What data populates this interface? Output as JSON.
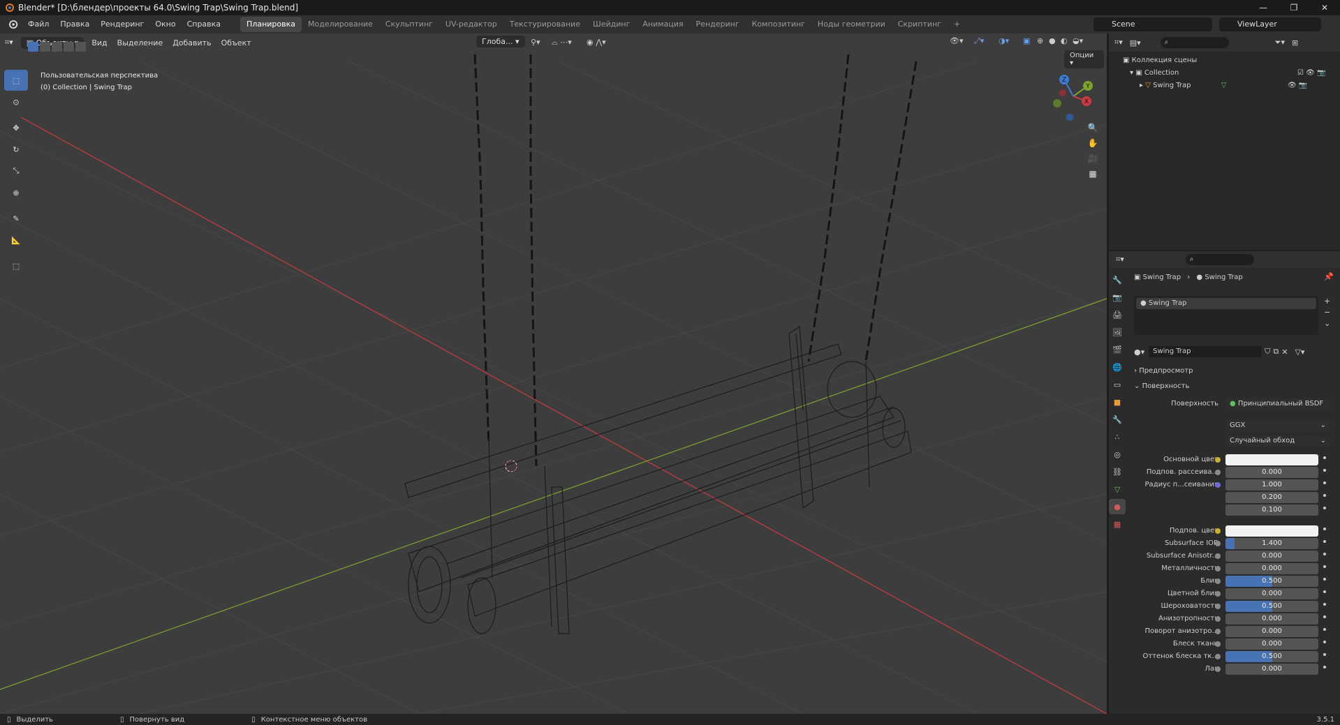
{
  "window": {
    "title": "Blender* [D:\\блендер\\проекты 64.0\\Swing Trap\\Swing Trap.blend]",
    "controls": [
      "—",
      "❐",
      "✕"
    ]
  },
  "menubar": {
    "menus": [
      "Файл",
      "Правка",
      "Рендеринг",
      "Окно",
      "Справка"
    ],
    "workspaces": [
      "Планировка",
      "Моделирование",
      "Скульптинг",
      "UV-редактор",
      "Текстурирование",
      "Шейдинг",
      "Анимация",
      "Рендеринг",
      "Композитинг",
      "Ноды геометрии",
      "Скриптинг",
      "+"
    ],
    "active_workspace": "Планировка",
    "scene": "Scene",
    "view_layer": "ViewLayer"
  },
  "viewport": {
    "mode": "Объекты",
    "menus": [
      "Вид",
      "Выделение",
      "Добавить",
      "Объект"
    ],
    "transform_orientation": "Глоба...",
    "options_label": "Опции",
    "overlay_text_1": "Пользовательская перспектива",
    "overlay_text_2": "(0) Collection | Swing Trap",
    "gizmo_axes": [
      "X",
      "Y",
      "Z"
    ]
  },
  "outliner": {
    "search_placeholder": "",
    "scene_collection": "Коллекция сцены",
    "collection": "Collection",
    "object": "Swing Trap"
  },
  "properties": {
    "breadcrumb_object": "Swing Trap",
    "breadcrumb_material": "Swing Trap",
    "material_slot": "Swing Trap",
    "material_name": "Swing Trap",
    "panel_preview": "Предпросмотр",
    "panel_surface": "Поверхность",
    "surface_label": "Поверхность",
    "surface_shader": "Принципиальный BSDF",
    "distribution": "GGX",
    "subsurface_method": "Случайный обход",
    "rows": [
      {
        "label": "Основной цвет",
        "value": "",
        "type": "color",
        "dot": "yellow"
      },
      {
        "label": "Подпов. рассеива...",
        "value": "0.000",
        "fill": 0,
        "dot": "grey"
      },
      {
        "label": "Радиус п...сеивания",
        "value": "1.000",
        "fill": 0,
        "dot": "blue"
      },
      {
        "label": "",
        "value": "0.200",
        "fill": 0,
        "dot": "none"
      },
      {
        "label": "",
        "value": "0.100",
        "fill": 0,
        "dot": "none"
      },
      {
        "label": "Подпов. цвет",
        "value": "",
        "type": "color",
        "dot": "yellow"
      },
      {
        "label": "Subsurface IOR",
        "value": "1.400",
        "fill": 0.1,
        "dot": "grey"
      },
      {
        "label": "Subsurface Anisotr...",
        "value": "0.000",
        "fill": 0,
        "dot": "grey"
      },
      {
        "label": "Металличность",
        "value": "0.000",
        "fill": 0,
        "dot": "grey"
      },
      {
        "label": "Блик",
        "value": "0.500",
        "fill": 0.5,
        "dot": "grey"
      },
      {
        "label": "Цветной блик",
        "value": "0.000",
        "fill": 0,
        "dot": "grey"
      },
      {
        "label": "Шероховатость",
        "value": "0.500",
        "fill": 0.5,
        "dot": "grey"
      },
      {
        "label": "Анизотропность",
        "value": "0.000",
        "fill": 0,
        "dot": "grey"
      },
      {
        "label": "Поворот анизотро...",
        "value": "0.000",
        "fill": 0,
        "dot": "grey"
      },
      {
        "label": "Блеск ткани",
        "value": "0.000",
        "fill": 0,
        "dot": "grey"
      },
      {
        "label": "Оттенок блеска тк...",
        "value": "0.500",
        "fill": 0.5,
        "dot": "grey"
      },
      {
        "label": "Лак",
        "value": "0.000",
        "fill": 0,
        "dot": "grey"
      }
    ]
  },
  "statusbar": {
    "item1": "Выделить",
    "item2": "Повернуть вид",
    "item3": "Контекстное меню объектов",
    "version": "3.5.1"
  },
  "colors": {
    "accent": "#4772b3",
    "x_axis": "#c93b44",
    "y_axis": "#7da52e",
    "z_axis": "#3b7bd6",
    "viewport_bg": "#3d3d3d"
  }
}
